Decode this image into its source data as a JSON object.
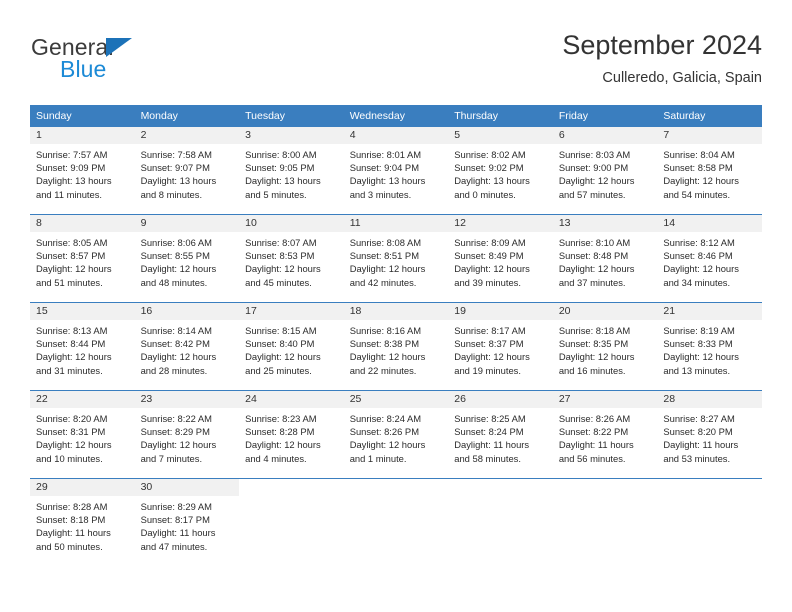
{
  "logo": {
    "word_top": "General",
    "word_bottom": "Blue",
    "triangle_color": "#1c72b8",
    "blue_color": "#1c8ad6"
  },
  "header": {
    "title": "September 2024",
    "subtitle": "Culleredo, Galicia, Spain"
  },
  "theme": {
    "header_blue": "#3a7ebf",
    "daynum_band": "#f1f1f1",
    "text": "#2b2b2b"
  },
  "weekdays": [
    "Sunday",
    "Monday",
    "Tuesday",
    "Wednesday",
    "Thursday",
    "Friday",
    "Saturday"
  ],
  "weeks": [
    [
      {
        "day": "1",
        "sunrise": "Sunrise: 7:57 AM",
        "sunset": "Sunset: 9:09 PM",
        "daylight_line1": "Daylight: 13 hours",
        "daylight_line2": "and 11 minutes."
      },
      {
        "day": "2",
        "sunrise": "Sunrise: 7:58 AM",
        "sunset": "Sunset: 9:07 PM",
        "daylight_line1": "Daylight: 13 hours",
        "daylight_line2": "and 8 minutes."
      },
      {
        "day": "3",
        "sunrise": "Sunrise: 8:00 AM",
        "sunset": "Sunset: 9:05 PM",
        "daylight_line1": "Daylight: 13 hours",
        "daylight_line2": "and 5 minutes."
      },
      {
        "day": "4",
        "sunrise": "Sunrise: 8:01 AM",
        "sunset": "Sunset: 9:04 PM",
        "daylight_line1": "Daylight: 13 hours",
        "daylight_line2": "and 3 minutes."
      },
      {
        "day": "5",
        "sunrise": "Sunrise: 8:02 AM",
        "sunset": "Sunset: 9:02 PM",
        "daylight_line1": "Daylight: 13 hours",
        "daylight_line2": "and 0 minutes."
      },
      {
        "day": "6",
        "sunrise": "Sunrise: 8:03 AM",
        "sunset": "Sunset: 9:00 PM",
        "daylight_line1": "Daylight: 12 hours",
        "daylight_line2": "and 57 minutes."
      },
      {
        "day": "7",
        "sunrise": "Sunrise: 8:04 AM",
        "sunset": "Sunset: 8:58 PM",
        "daylight_line1": "Daylight: 12 hours",
        "daylight_line2": "and 54 minutes."
      }
    ],
    [
      {
        "day": "8",
        "sunrise": "Sunrise: 8:05 AM",
        "sunset": "Sunset: 8:57 PM",
        "daylight_line1": "Daylight: 12 hours",
        "daylight_line2": "and 51 minutes."
      },
      {
        "day": "9",
        "sunrise": "Sunrise: 8:06 AM",
        "sunset": "Sunset: 8:55 PM",
        "daylight_line1": "Daylight: 12 hours",
        "daylight_line2": "and 48 minutes."
      },
      {
        "day": "10",
        "sunrise": "Sunrise: 8:07 AM",
        "sunset": "Sunset: 8:53 PM",
        "daylight_line1": "Daylight: 12 hours",
        "daylight_line2": "and 45 minutes."
      },
      {
        "day": "11",
        "sunrise": "Sunrise: 8:08 AM",
        "sunset": "Sunset: 8:51 PM",
        "daylight_line1": "Daylight: 12 hours",
        "daylight_line2": "and 42 minutes."
      },
      {
        "day": "12",
        "sunrise": "Sunrise: 8:09 AM",
        "sunset": "Sunset: 8:49 PM",
        "daylight_line1": "Daylight: 12 hours",
        "daylight_line2": "and 39 minutes."
      },
      {
        "day": "13",
        "sunrise": "Sunrise: 8:10 AM",
        "sunset": "Sunset: 8:48 PM",
        "daylight_line1": "Daylight: 12 hours",
        "daylight_line2": "and 37 minutes."
      },
      {
        "day": "14",
        "sunrise": "Sunrise: 8:12 AM",
        "sunset": "Sunset: 8:46 PM",
        "daylight_line1": "Daylight: 12 hours",
        "daylight_line2": "and 34 minutes."
      }
    ],
    [
      {
        "day": "15",
        "sunrise": "Sunrise: 8:13 AM",
        "sunset": "Sunset: 8:44 PM",
        "daylight_line1": "Daylight: 12 hours",
        "daylight_line2": "and 31 minutes."
      },
      {
        "day": "16",
        "sunrise": "Sunrise: 8:14 AM",
        "sunset": "Sunset: 8:42 PM",
        "daylight_line1": "Daylight: 12 hours",
        "daylight_line2": "and 28 minutes."
      },
      {
        "day": "17",
        "sunrise": "Sunrise: 8:15 AM",
        "sunset": "Sunset: 8:40 PM",
        "daylight_line1": "Daylight: 12 hours",
        "daylight_line2": "and 25 minutes."
      },
      {
        "day": "18",
        "sunrise": "Sunrise: 8:16 AM",
        "sunset": "Sunset: 8:38 PM",
        "daylight_line1": "Daylight: 12 hours",
        "daylight_line2": "and 22 minutes."
      },
      {
        "day": "19",
        "sunrise": "Sunrise: 8:17 AM",
        "sunset": "Sunset: 8:37 PM",
        "daylight_line1": "Daylight: 12 hours",
        "daylight_line2": "and 19 minutes."
      },
      {
        "day": "20",
        "sunrise": "Sunrise: 8:18 AM",
        "sunset": "Sunset: 8:35 PM",
        "daylight_line1": "Daylight: 12 hours",
        "daylight_line2": "and 16 minutes."
      },
      {
        "day": "21",
        "sunrise": "Sunrise: 8:19 AM",
        "sunset": "Sunset: 8:33 PM",
        "daylight_line1": "Daylight: 12 hours",
        "daylight_line2": "and 13 minutes."
      }
    ],
    [
      {
        "day": "22",
        "sunrise": "Sunrise: 8:20 AM",
        "sunset": "Sunset: 8:31 PM",
        "daylight_line1": "Daylight: 12 hours",
        "daylight_line2": "and 10 minutes."
      },
      {
        "day": "23",
        "sunrise": "Sunrise: 8:22 AM",
        "sunset": "Sunset: 8:29 PM",
        "daylight_line1": "Daylight: 12 hours",
        "daylight_line2": "and 7 minutes."
      },
      {
        "day": "24",
        "sunrise": "Sunrise: 8:23 AM",
        "sunset": "Sunset: 8:28 PM",
        "daylight_line1": "Daylight: 12 hours",
        "daylight_line2": "and 4 minutes."
      },
      {
        "day": "25",
        "sunrise": "Sunrise: 8:24 AM",
        "sunset": "Sunset: 8:26 PM",
        "daylight_line1": "Daylight: 12 hours",
        "daylight_line2": "and 1 minute."
      },
      {
        "day": "26",
        "sunrise": "Sunrise: 8:25 AM",
        "sunset": "Sunset: 8:24 PM",
        "daylight_line1": "Daylight: 11 hours",
        "daylight_line2": "and 58 minutes."
      },
      {
        "day": "27",
        "sunrise": "Sunrise: 8:26 AM",
        "sunset": "Sunset: 8:22 PM",
        "daylight_line1": "Daylight: 11 hours",
        "daylight_line2": "and 56 minutes."
      },
      {
        "day": "28",
        "sunrise": "Sunrise: 8:27 AM",
        "sunset": "Sunset: 8:20 PM",
        "daylight_line1": "Daylight: 11 hours",
        "daylight_line2": "and 53 minutes."
      }
    ],
    [
      {
        "day": "29",
        "sunrise": "Sunrise: 8:28 AM",
        "sunset": "Sunset: 8:18 PM",
        "daylight_line1": "Daylight: 11 hours",
        "daylight_line2": "and 50 minutes."
      },
      {
        "day": "30",
        "sunrise": "Sunrise: 8:29 AM",
        "sunset": "Sunset: 8:17 PM",
        "daylight_line1": "Daylight: 11 hours",
        "daylight_line2": "and 47 minutes."
      },
      {
        "day": "",
        "sunrise": "",
        "sunset": "",
        "daylight_line1": "",
        "daylight_line2": ""
      },
      {
        "day": "",
        "sunrise": "",
        "sunset": "",
        "daylight_line1": "",
        "daylight_line2": ""
      },
      {
        "day": "",
        "sunrise": "",
        "sunset": "",
        "daylight_line1": "",
        "daylight_line2": ""
      },
      {
        "day": "",
        "sunrise": "",
        "sunset": "",
        "daylight_line1": "",
        "daylight_line2": ""
      },
      {
        "day": "",
        "sunrise": "",
        "sunset": "",
        "daylight_line1": "",
        "daylight_line2": ""
      }
    ]
  ]
}
